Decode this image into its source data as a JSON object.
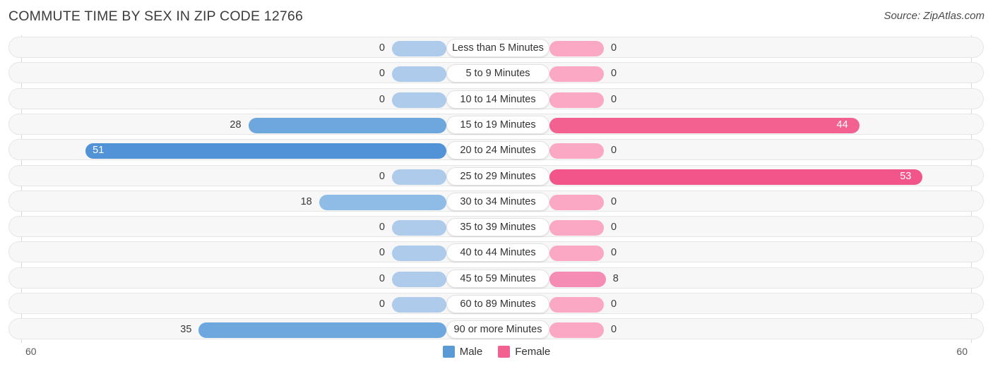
{
  "header": {
    "title": "COMMUTE TIME BY SEX IN ZIP CODE 12766",
    "source": "Source: ZipAtlas.com"
  },
  "legend": {
    "male_label": "Male",
    "female_label": "Female",
    "male_color": "#5b9bd5",
    "female_color": "#f2618f"
  },
  "axis": {
    "left_tick": "60",
    "right_tick": "60",
    "max": 60
  },
  "chart_data": {
    "type": "bar",
    "orientation": "horizontal-diverging",
    "title": "COMMUTE TIME BY SEX IN ZIP CODE 12766",
    "xlabel": "",
    "ylabel": "",
    "xlim": [
      60,
      60
    ],
    "grid": false,
    "legend_position": "bottom-center",
    "categories": [
      "Less than 5 Minutes",
      "5 to 9 Minutes",
      "10 to 14 Minutes",
      "15 to 19 Minutes",
      "20 to 24 Minutes",
      "25 to 29 Minutes",
      "30 to 34 Minutes",
      "35 to 39 Minutes",
      "40 to 44 Minutes",
      "45 to 59 Minutes",
      "60 to 89 Minutes",
      "90 or more Minutes"
    ],
    "series": [
      {
        "name": "Male",
        "values": [
          0,
          0,
          0,
          28,
          51,
          0,
          18,
          0,
          0,
          0,
          0,
          35
        ]
      },
      {
        "name": "Female",
        "values": [
          0,
          0,
          0,
          44,
          0,
          53,
          0,
          0,
          0,
          8,
          0,
          0
        ]
      }
    ]
  },
  "rows": [
    {
      "label": "Less than 5 Minutes",
      "male": "0",
      "female": "0"
    },
    {
      "label": "5 to 9 Minutes",
      "male": "0",
      "female": "0"
    },
    {
      "label": "10 to 14 Minutes",
      "male": "0",
      "female": "0"
    },
    {
      "label": "15 to 19 Minutes",
      "male": "28",
      "female": "44"
    },
    {
      "label": "20 to 24 Minutes",
      "male": "51",
      "female": "0"
    },
    {
      "label": "25 to 29 Minutes",
      "male": "0",
      "female": "53"
    },
    {
      "label": "30 to 34 Minutes",
      "male": "18",
      "female": "0"
    },
    {
      "label": "35 to 39 Minutes",
      "male": "0",
      "female": "0"
    },
    {
      "label": "40 to 44 Minutes",
      "male": "0",
      "female": "0"
    },
    {
      "label": "45 to 59 Minutes",
      "male": "0",
      "female": "8"
    },
    {
      "label": "60 to 89 Minutes",
      "male": "0",
      "female": "0"
    },
    {
      "label": "90 or more Minutes",
      "male": "35",
      "female": "0"
    }
  ]
}
